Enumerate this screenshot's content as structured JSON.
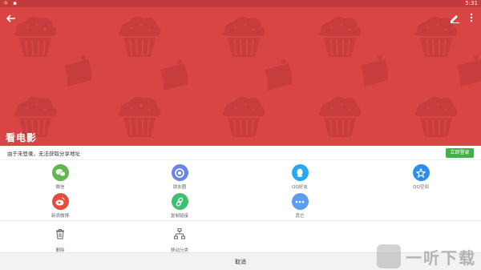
{
  "status_bar": {
    "time": "5:31"
  },
  "hero": {
    "title": "看电影",
    "bg_color": "#d94545"
  },
  "login_bar": {
    "message": "由于未登录，无法获取分享地址",
    "login_button": "立即登录",
    "button_color": "#43b04a"
  },
  "share_row_1": [
    {
      "label": "微信",
      "icon": "wechat-icon",
      "color": "#62b84b"
    },
    {
      "label": "朋友圈",
      "icon": "moments-icon",
      "color": "#6b85e6"
    },
    {
      "label": "QQ好友",
      "icon": "qq-icon",
      "color": "#28a9ed"
    },
    {
      "label": "QQ空间",
      "icon": "qzone-star-icon",
      "color": "#2c8df0"
    }
  ],
  "share_row_2": [
    {
      "label": "新浪微博",
      "icon": "weibo-icon",
      "color": "#e24d3d"
    },
    {
      "label": "复制链接",
      "icon": "link-icon",
      "color": "#3fbf72"
    },
    {
      "label": "其它",
      "icon": "more-dots-icon",
      "color": "#5b9df3"
    }
  ],
  "tools": [
    {
      "label": "删除",
      "icon": "trash-icon"
    },
    {
      "label": "移动分类",
      "icon": "move-category-icon"
    }
  ],
  "cancel_label": "取消",
  "watermark_text": "一听下载"
}
